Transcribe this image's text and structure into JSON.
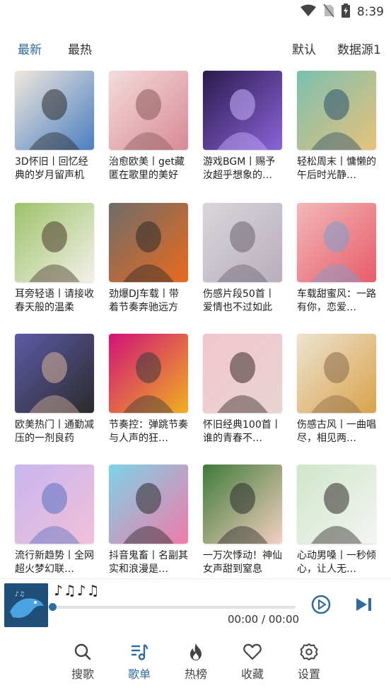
{
  "status_bar": {
    "time": "8:39"
  },
  "top_tabs": {
    "latest": "最新",
    "hottest": "最热",
    "default": "默认",
    "data_source": "数据源1"
  },
  "playlists": [
    {
      "title": "3D怀旧丨回忆经典的岁月留声机",
      "colors": [
        "#f0e7dd",
        "#4a7fc0",
        "#2b2b2b"
      ]
    },
    {
      "title": "治愈欧美丨get藏匿在歌里的美好",
      "colors": [
        "#f3dcdc",
        "#d88a95",
        "#8a5a5a"
      ]
    },
    {
      "title": "游戏BGM丨赐予汝超乎想象的…",
      "colors": [
        "#2a1b4d",
        "#8b63d8",
        "#c9b3ff"
      ]
    },
    {
      "title": "轻松周末丨慵懒的午后时光静…",
      "colors": [
        "#7bbfb0",
        "#e7c27a",
        "#2c4f6d"
      ]
    },
    {
      "title": "耳旁轻语丨请接收春天般的温柔",
      "colors": [
        "#9cc36a",
        "#f4f0e8",
        "#4a3a2a"
      ]
    },
    {
      "title": "劲爆DJ车载丨带着节奏奔驰远方",
      "colors": [
        "#6f6c6a",
        "#e96a1c",
        "#2b2b2b"
      ]
    },
    {
      "title": "伤感片段50首丨爱情也不过如此",
      "colors": [
        "#d9d6da",
        "#b8aebc",
        "#6b6470"
      ]
    },
    {
      "title": "车载甜蜜风：一路有你，恋爱…",
      "colors": [
        "#f2b8b8",
        "#e85c6a",
        "#7a9fd0"
      ]
    },
    {
      "title": "欧美热门丨通勤减压的一剂良药",
      "colors": [
        "#5d5aa8",
        "#2b2b2b",
        "#d7b39b"
      ]
    },
    {
      "title": "节奏控：弹跳节奏与人声的狂…",
      "colors": [
        "#d1127a",
        "#f0b020",
        "#3a3a3a"
      ]
    },
    {
      "title": "怀旧经典100首丨谁的青春不…",
      "colors": [
        "#f2c6cf",
        "#e8d3d3",
        "#3a2a2a"
      ]
    },
    {
      "title": "伤感古风丨一曲唱尽，相见两…",
      "colors": [
        "#ece4d2",
        "#d9a24a",
        "#8a6a4a"
      ]
    },
    {
      "title": "流行新趋势丨全网超火梦幻联…",
      "colors": [
        "#c8b6f0",
        "#f0c0d8",
        "#5a6fc0"
      ]
    },
    {
      "title": "抖音鬼畜丨名副其实和浪漫是…",
      "colors": [
        "#7dd3e8",
        "#f07aa8",
        "#2b2b2b"
      ]
    },
    {
      "title": "一万次悸动！神仙女声甜到窒息",
      "colors": [
        "#3f7a3a",
        "#f4d0c0",
        "#2b2b2b"
      ]
    },
    {
      "title": "心动男嗓丨一秒倾心，让人无…",
      "colors": [
        "#cfe6c8",
        "#f4f4f4",
        "#2f2a28"
      ]
    }
  ],
  "player": {
    "song_title": "♪♫♪♫",
    "time": "00:00 / 00:00",
    "progress": 0
  },
  "bottom_nav": {
    "search": "搜歌",
    "playlist": "歌单",
    "charts": "热榜",
    "favorites": "收藏",
    "settings": "设置"
  },
  "accent_color": "#2f6b9c"
}
